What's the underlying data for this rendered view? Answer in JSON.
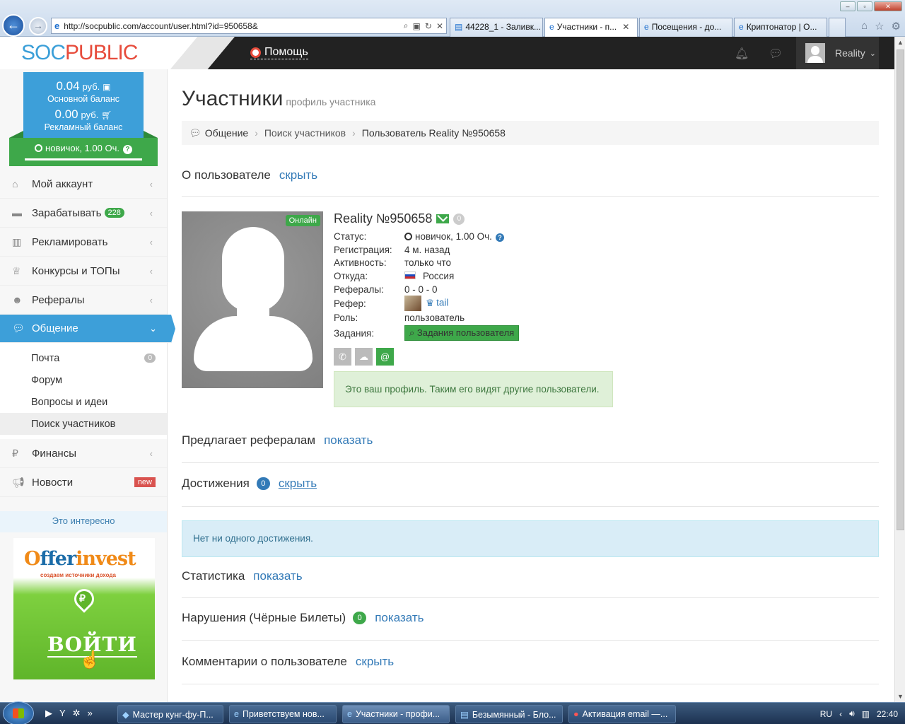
{
  "browser": {
    "url": "http://socpublic.com/account/user.html?id=950658&",
    "tabs": [
      {
        "label": "44228_1 - Заливк..."
      },
      {
        "label": "Участники - п..."
      },
      {
        "label": "Посещения - до..."
      },
      {
        "label": "Криптонатор | О..."
      }
    ]
  },
  "header": {
    "logo_soc": "SOC",
    "logo_pub": "PUBLIC",
    "help": "Помощь",
    "username": "Reality"
  },
  "sidebar": {
    "balance_main": "0.04",
    "balance_main_cur": "руб.",
    "balance_main_label": "Основной баланс",
    "balance_ad": "0.00",
    "balance_ad_cur": "руб.",
    "balance_ad_label": "Рекламный баланс",
    "rank": "новичок, 1.00 Оч.",
    "menu": [
      {
        "label": "Мой аккаунт"
      },
      {
        "label": "Зарабатывать",
        "badge": "228"
      },
      {
        "label": "Рекламировать"
      },
      {
        "label": "Конкурсы и ТОПы"
      },
      {
        "label": "Рефералы"
      },
      {
        "label": "Общение"
      },
      {
        "label": "Финансы"
      },
      {
        "label": "Новости",
        "badge": "new"
      }
    ],
    "submenu": [
      {
        "label": "Почта",
        "count": "0"
      },
      {
        "label": "Форум"
      },
      {
        "label": "Вопросы и идеи"
      },
      {
        "label": "Поиск участников"
      }
    ],
    "interesting": "Это интересно",
    "ad_brand_1": "ffer",
    "ad_brand_2": "invest",
    "ad_brand_0": "O",
    "ad_tag": "создаем источники дохода",
    "ad_button": "ВОЙТИ"
  },
  "page": {
    "title": "Участники",
    "subtitle": "профиль участника",
    "breadcrumb": [
      "Общение",
      "Поиск участников",
      "Пользователь Reality №950658"
    ]
  },
  "about": {
    "title": "О пользователе",
    "toggle": "скрыть",
    "online": "Онлайн",
    "name": "Reality №950658",
    "msg_count": "0",
    "fields": {
      "status_k": "Статус:",
      "status_v": "новичок, 1.00 Оч.",
      "reg_k": "Регистрация:",
      "reg_v": "4 м. назад",
      "act_k": "Активность:",
      "act_v": "только что",
      "from_k": "Откуда:",
      "from_v": "Россия",
      "refs_k": "Рефералы:",
      "refs_v": "0 - 0 - 0",
      "referer_k": "Рефер:",
      "referer_v": "tail",
      "role_k": "Роль:",
      "role_v": "пользователь",
      "tasks_k": "Задания:",
      "tasks_v": "Задания пользователя"
    },
    "own_profile_note": "Это ваш профиль. Таким его видят другие пользователи."
  },
  "sections": {
    "offers_title": "Предлагает рефералам",
    "offers_toggle": "показать",
    "ach_title": "Достижения",
    "ach_count": "0",
    "ach_toggle": "скрыть",
    "ach_empty": "Нет ни одного достижения.",
    "stats_title": "Статистика",
    "stats_toggle": "показать",
    "viol_title": "Нарушения (Чёрные Билеты)",
    "viol_count": "0",
    "viol_toggle": "показать",
    "comm_title": "Комментарии о пользователе",
    "comm_toggle": "скрыть"
  },
  "taskbar": {
    "tasks": [
      {
        "label": "Мастер кунг-фу-П..."
      },
      {
        "label": "Приветствуем нов..."
      },
      {
        "label": "Участники - профи..."
      },
      {
        "label": "Безымянный - Бло..."
      },
      {
        "label": "Активация email —..."
      }
    ],
    "lang": "RU",
    "time": "22:40"
  }
}
